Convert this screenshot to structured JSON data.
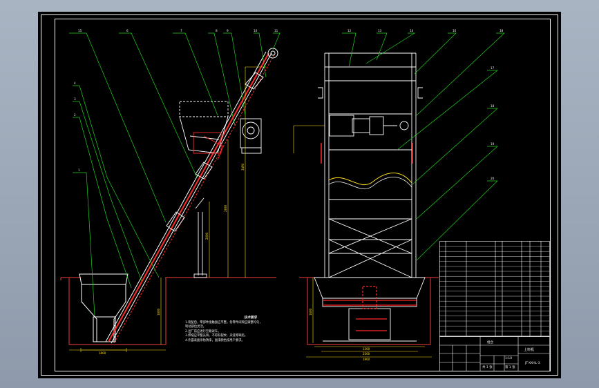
{
  "colors": {
    "background": "#000000",
    "frame": "#ffffff",
    "leader": "#1fd41f",
    "structure": "#ffffff",
    "highlight": "#ff2b2b",
    "dimension": "#ffe11a",
    "ground": "#c83232"
  },
  "balloons": {
    "front": [
      "15",
      "6",
      "7",
      "8",
      "9",
      "10",
      "11",
      "4",
      "3",
      "2",
      "1"
    ],
    "side": [
      "12",
      "13",
      "14",
      "16",
      "18",
      "17",
      "18",
      "19",
      "20"
    ]
  },
  "dimensions": {
    "total_height": "3490",
    "mid_height": "2830",
    "lower_height": "2000",
    "hopper_height": "1600",
    "hopper_width": "1600",
    "pit_width": "2500",
    "base_width": "1200",
    "side_height": "1600",
    "side_base": "1900"
  },
  "notes": {
    "title": "技术要求",
    "lines": [
      "1.装配后，零部件接触面应平整，各零件间隙应调整均匀，",
      "   转动部位灵活。",
      "2.出厂前应进行空载试车。",
      "3.焊缝应平整光滑，不得有裂纹、夹渣等缺陷。",
      "4.外露表面涂防锈漆，面漆颜色按用户要求。"
    ]
  },
  "title_block": {
    "drawing_name": "上料机",
    "drawing_number": "JT-XXHL-3",
    "material": "组合",
    "scale": "1:10",
    "sheet": "共 1 张",
    "sheet_of": "第 1 张"
  }
}
